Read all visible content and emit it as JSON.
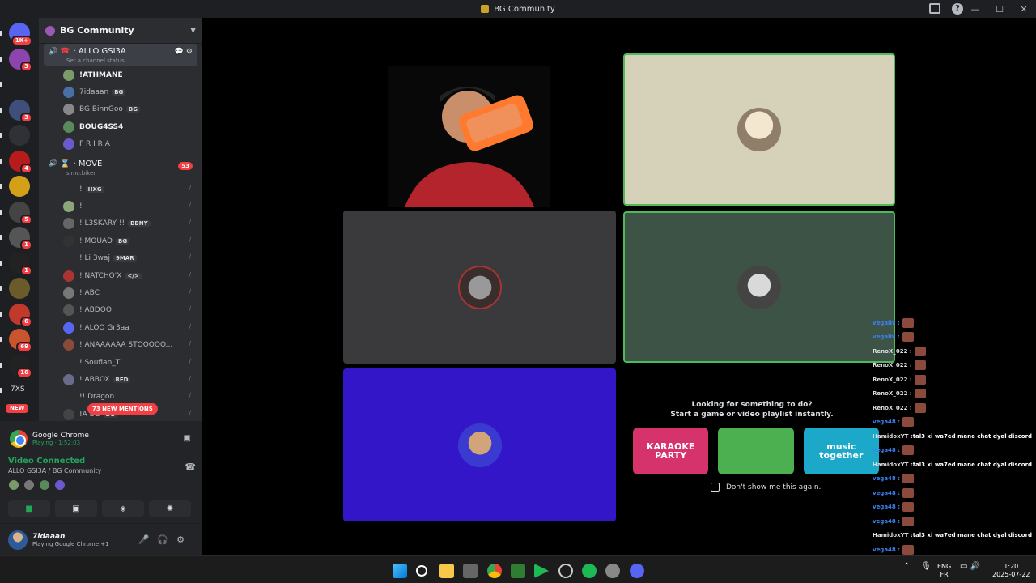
{
  "window": {
    "title": "BG Community"
  },
  "servers": [
    {
      "name": "discord-home",
      "badge": "1K+",
      "color": "#5865f2"
    },
    {
      "name": "server-2",
      "badge": "3",
      "color": "#8e44ad"
    },
    {
      "name": "server-3",
      "badge": "",
      "color": "#1e1f22"
    },
    {
      "name": "server-4",
      "badge": "3",
      "color": "#3d4f7a"
    },
    {
      "name": "server-5",
      "badge": "",
      "color": "#2f3136"
    },
    {
      "name": "server-6",
      "badge": "4",
      "color": "#b71c1c"
    },
    {
      "name": "server-stake",
      "badge": "",
      "color": "#d4a017"
    },
    {
      "name": "server-8",
      "badge": "5",
      "color": "#444"
    },
    {
      "name": "server-9",
      "badge": "1",
      "color": "#555"
    },
    {
      "name": "server-rc",
      "badge": "1",
      "color": "#222"
    },
    {
      "name": "server-11",
      "badge": "",
      "color": "#6b5b2a"
    },
    {
      "name": "server-12",
      "badge": "6",
      "color": "#c0392b"
    },
    {
      "name": "server-13",
      "badge": "69",
      "color": "#c9542e"
    },
    {
      "name": "server-fx",
      "badge": "16",
      "color": "#222"
    },
    {
      "name": "server-7xs",
      "label": "7XS",
      "badge": "NEW",
      "color": "#1e1f22"
    }
  ],
  "sidebar": {
    "server_name": "BG Community",
    "active_channel": {
      "name": "ALLO GSI3A",
      "status": "Set a channel status"
    },
    "members_a": [
      {
        "name": "!ATHMANE",
        "tag": "",
        "bright": true,
        "color": "#7a9a6a"
      },
      {
        "name": "7idaaan",
        "tag": "BG",
        "bright": false,
        "color": "#4a6fa5"
      },
      {
        "name": "BG BinnGoo",
        "tag": "BG",
        "bright": false,
        "color": "#888"
      },
      {
        "name": "BOUG4SS4",
        "tag": "",
        "bright": true,
        "color": "#5a8a5a"
      },
      {
        "name": "F R I R A",
        "tag": "",
        "bright": false,
        "color": "#6a5acd"
      }
    ],
    "channel_move": {
      "name": "MOVE",
      "status": "simo.biker",
      "count": "53"
    },
    "members_b": [
      {
        "name": "!",
        "tag": "HXG",
        "color": "#2b2d31"
      },
      {
        "name": "!",
        "tag": "",
        "color": "#8aa67a"
      },
      {
        "name": "! L3SKARY !!",
        "tag": "BBNY",
        "color": "#666"
      },
      {
        "name": "! MOUAD",
        "tag": "BG",
        "color": "#333"
      },
      {
        "name": "! Li 3waj",
        "tag": "9MAR",
        "color": "#2b2d31"
      },
      {
        "name": "! NATCHO'X",
        "tag": "</>",
        "color": "#a33"
      },
      {
        "name": "! ABC",
        "tag": "",
        "color": "#777"
      },
      {
        "name": "! ABDOO",
        "tag": "",
        "color": "#555"
      },
      {
        "name": "! ALOO Gr3aa",
        "tag": "",
        "color": "#5865f2"
      },
      {
        "name": "! ANAAAAAA STOOOOO...",
        "tag": "",
        "color": "#8a4a3a"
      },
      {
        "name": "!  Soufian_TI",
        "tag": "",
        "color": "#2b2d31"
      },
      {
        "name": "! ABBOX",
        "tag": "RED",
        "color": "#6a6a8a"
      },
      {
        "name": "!! Dragon",
        "tag": "",
        "color": "#2b2d31"
      },
      {
        "name": "!A BG",
        "tag": "BG",
        "color": "#444"
      }
    ],
    "new_mentions": "73 NEW MENTIONS"
  },
  "activity": {
    "app": "Google Chrome",
    "status": "Playing · 1:52:03"
  },
  "voice": {
    "state": "Video Connected",
    "location": "ALLO GSI3A / BG Community"
  },
  "user": {
    "name": "7idaaan",
    "status": "Playing Google Chrome +1"
  },
  "game_prompt": {
    "line1": "Looking for something to do?",
    "line2": "Start a game or video playlist instantly.",
    "cards": [
      {
        "label": "KARAOKE PARTY",
        "color": "#d6336c"
      },
      {
        "label": "",
        "color": "#4caf50"
      },
      {
        "label": "music together",
        "color": "#1ca9c9"
      }
    ],
    "dont_show": "Don't show me this again."
  },
  "chat": [
    {
      "name": "vegaliv",
      "text": "",
      "blue": true
    },
    {
      "name": "vegaliv",
      "text": "",
      "blue": true
    },
    {
      "name": "RenoX_022",
      "text": "",
      "blue": false
    },
    {
      "name": "RenoX_022",
      "text": "",
      "blue": false
    },
    {
      "name": "RenoX_022",
      "text": "",
      "blue": false
    },
    {
      "name": "RenoX_022",
      "text": "",
      "blue": false
    },
    {
      "name": "RenoX_022",
      "text": "",
      "blue": false
    },
    {
      "name": "vega48",
      "text": "",
      "blue": true
    },
    {
      "name": "HamidoxYT",
      "text": "tal3 xi wa7ed mane chat dyal discord",
      "blue": false
    },
    {
      "name": "vega48",
      "text": "",
      "blue": true
    },
    {
      "name": "HamidoxYT",
      "text": "tal3 xi wa7ed mane chat dyal discord",
      "blue": false
    },
    {
      "name": "vega48",
      "text": "",
      "blue": true
    },
    {
      "name": "vega48",
      "text": "",
      "blue": true
    },
    {
      "name": "vega48",
      "text": "",
      "blue": true
    },
    {
      "name": "vega48",
      "text": "",
      "blue": true
    },
    {
      "name": "HamidoxYT",
      "text": "tal3 xi wa7ed mane chat dyal discord",
      "blue": false
    },
    {
      "name": "vega48",
      "text": "",
      "blue": true
    }
  ],
  "taskbar": {
    "lang1": "ENG",
    "lang2": "FR",
    "time": "1:20",
    "date": "2025-07-22"
  }
}
